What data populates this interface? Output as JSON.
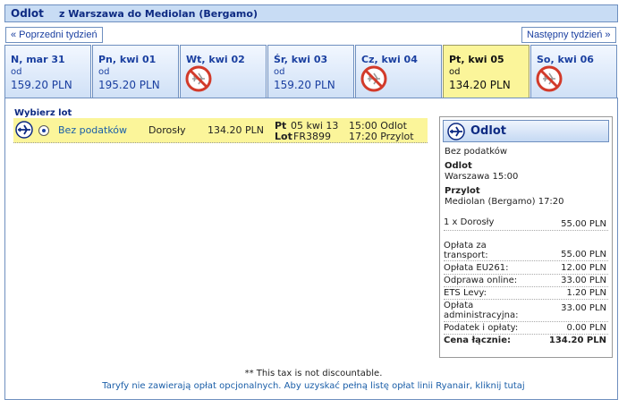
{
  "header": {
    "title": "Odlot",
    "route": "z Warszawa do Mediolan (Bergamo)"
  },
  "nav": {
    "prev": "« Poprzedni tydzień",
    "next": "Następny tydzień »"
  },
  "tabs": [
    {
      "date": "N, mar 31",
      "from": "od",
      "price": "159.20 PLN"
    },
    {
      "date": "Pn, kwi 01",
      "from": "od",
      "price": "195.20 PLN"
    },
    {
      "date": "Wt, kwi 02",
      "from": "",
      "price": "",
      "icon": "no-flights-icon"
    },
    {
      "date": "Śr, kwi 03",
      "from": "od",
      "price": "159.20 PLN"
    },
    {
      "date": "Cz, kwi 04",
      "from": "",
      "price": "",
      "icon": "no-flights-icon"
    },
    {
      "date": "Pt, kwi 05",
      "from": "od",
      "price": "134.20 PLN"
    },
    {
      "date": "So, kwi 06",
      "from": "",
      "price": "",
      "icon": "no-flights-icon"
    }
  ],
  "select_label": "Wybierz lot",
  "flight": {
    "fare": "Bez podatków",
    "passenger": "Dorosły",
    "price": "134.20 PLN",
    "day": "Pt",
    "date": "05 kwi 13",
    "flight_label": "Lot",
    "flight_no": "FR3899",
    "dep_time": "15:00 Odlot",
    "arr_time": "17:20 Przylot"
  },
  "summary": {
    "title": "Odlot",
    "fare": "Bez podatków",
    "dep_label": "Odlot",
    "dep_value": "Warszawa 15:00",
    "arr_label": "Przylot",
    "arr_value": "Mediolan (Bergamo) 17:20",
    "pax_label": "1 x Dorosły",
    "pax_value": "55.00 PLN",
    "fees": [
      {
        "label": "Opłata za transport:",
        "value": "55.00 PLN"
      },
      {
        "label": "Opłata EU261:",
        "value": "12.00 PLN"
      },
      {
        "label": "Odprawa online:",
        "value": "33.00 PLN"
      },
      {
        "label": "ETS Levy:",
        "value": "1.20 PLN"
      },
      {
        "label": "Opłata administracyjna:",
        "value": "33.00 PLN"
      },
      {
        "label": "Podatek i opłaty:",
        "value": "0.00 PLN"
      }
    ],
    "total_label": "Cena łącznie:",
    "total_value": "134.20 PLN"
  },
  "footer": {
    "note": "** This tax is not discountable.",
    "link": "Taryfy nie zawierają opłat opcjonalnych. Aby uzyskać pełną listę opłat linii Ryanair, kliknij tutaj"
  },
  "colors": {
    "selected_tab": "#fbf59a",
    "brand_blue": "#0d2a82",
    "header_bg": "#c8dcf4"
  }
}
